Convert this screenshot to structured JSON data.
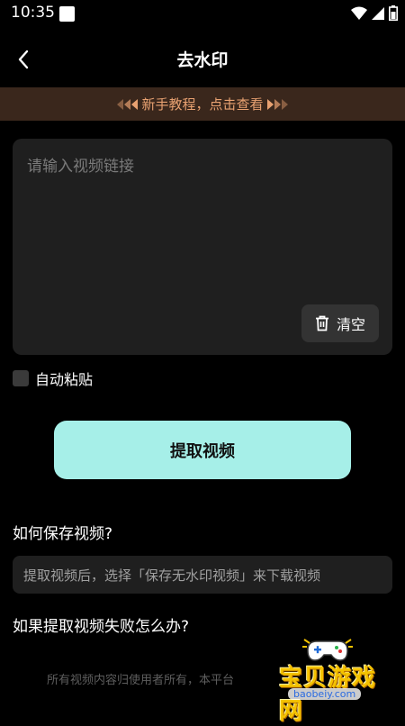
{
  "status_bar": {
    "time": "10:35"
  },
  "nav": {
    "title": "去水印"
  },
  "banner": {
    "text": "新手教程，点击查看"
  },
  "link_input": {
    "placeholder": "请输入视频链接",
    "value": ""
  },
  "clear_button": {
    "label": "清空"
  },
  "auto_paste": {
    "label": "自动粘贴",
    "checked": false
  },
  "extract_button": {
    "label": "提取视频"
  },
  "faq": [
    {
      "question": "如何保存视频?",
      "answer": "提取视频后，选择「保存无水印视频」来下载视频"
    },
    {
      "question": "如果提取视频失败怎么办?"
    }
  ],
  "disclaimer": "所有视频内容归使用者所有，本平台",
  "watermark": {
    "text": "宝贝游戏网",
    "url": "baobeiy.com"
  },
  "colors": {
    "accent": "#a6efe8",
    "banner_bg": "#3a271c",
    "banner_text": "#e8a171",
    "card_bg": "#1f1f1f"
  }
}
